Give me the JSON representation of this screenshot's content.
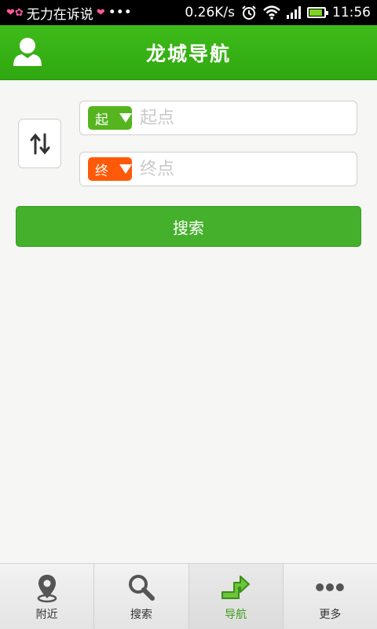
{
  "status_bar": {
    "carrier_text": "无力在诉说",
    "dots": "•••",
    "speed": "0.26K/s",
    "time": "11:56",
    "battery_level": 0.9
  },
  "header": {
    "title": "龙城导航"
  },
  "route": {
    "start": {
      "tag": "起",
      "placeholder": "起点",
      "value": ""
    },
    "end": {
      "tag": "终",
      "placeholder": "终点",
      "value": ""
    },
    "search_label": "搜索"
  },
  "tabs": [
    {
      "label": "附近",
      "icon": "location-pin-icon"
    },
    {
      "label": "搜索",
      "icon": "search-icon"
    },
    {
      "label": "导航",
      "icon": "route-arrow-icon",
      "active": true
    },
    {
      "label": "更多",
      "icon": "more-dots-icon"
    }
  ],
  "colors": {
    "header_green": "#33ad14",
    "start_tag": "#56b41f",
    "end_tag": "#ff5a0a",
    "search_button": "#45b02b",
    "active_tab": "#3f9e1c"
  }
}
